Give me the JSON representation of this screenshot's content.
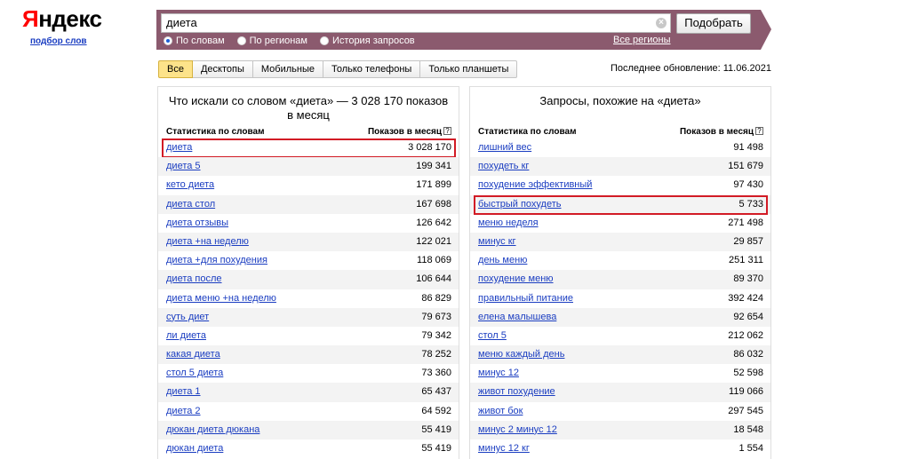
{
  "logo": {
    "text_first": "Я",
    "text_rest": "ндекс",
    "subtitle": "подбор слов"
  },
  "search": {
    "value": "диета",
    "clear_icon": "×",
    "submit_label": "Подобрать",
    "modes": [
      {
        "label": "По словам",
        "selected": true
      },
      {
        "label": "По регионам",
        "selected": false
      },
      {
        "label": "История запросов",
        "selected": false
      }
    ],
    "regions_link": "Все регионы"
  },
  "tabs": [
    {
      "label": "Все",
      "active": true
    },
    {
      "label": "Десктопы",
      "active": false
    },
    {
      "label": "Мобильные",
      "active": false
    },
    {
      "label": "Только телефоны",
      "active": false
    },
    {
      "label": "Только планшеты",
      "active": false
    }
  ],
  "last_update": "Последнее обновление: 11.06.2021",
  "left_panel": {
    "title": "Что искали со словом «диета» — 3 028 170 показов в месяц",
    "col_keyword": "Статистика по словам",
    "col_count": "Показов в месяц",
    "help_icon": "?",
    "rows": [
      {
        "keyword": "диета",
        "count": "3 028 170",
        "highlighted": true
      },
      {
        "keyword": "диета 5",
        "count": "199 341"
      },
      {
        "keyword": "кето диета",
        "count": "171 899"
      },
      {
        "keyword": "диета стол",
        "count": "167 698"
      },
      {
        "keyword": "диета отзывы",
        "count": "126 642"
      },
      {
        "keyword": "диета +на неделю",
        "count": "122 021"
      },
      {
        "keyword": "диета +для похудения",
        "count": "118 069"
      },
      {
        "keyword": "диета после",
        "count": "106 644"
      },
      {
        "keyword": "диета меню +на неделю",
        "count": "86 829"
      },
      {
        "keyword": "суть диет",
        "count": "79 673"
      },
      {
        "keyword": "ли диета",
        "count": "79 342"
      },
      {
        "keyword": "какая диета",
        "count": "78 252"
      },
      {
        "keyword": "стол 5 диета",
        "count": "73 360"
      },
      {
        "keyword": "диета 1",
        "count": "65 437"
      },
      {
        "keyword": "диета 2",
        "count": "64 592"
      },
      {
        "keyword": "дюкан диета дюкана",
        "count": "55 419"
      },
      {
        "keyword": "дюкан диета",
        "count": "55 419"
      }
    ]
  },
  "right_panel": {
    "title": "Запросы, похожие на «диета»",
    "col_keyword": "Статистика по словам",
    "col_count": "Показов в месяц",
    "help_icon": "?",
    "rows": [
      {
        "keyword": "лишний вес",
        "count": "91 498"
      },
      {
        "keyword": "похудеть кг",
        "count": "151 679"
      },
      {
        "keyword": "похудение эффективный",
        "count": "97 430"
      },
      {
        "keyword": "быстрый похудеть",
        "count": "5 733",
        "highlighted": true
      },
      {
        "keyword": "меню неделя",
        "count": "271 498"
      },
      {
        "keyword": "минус кг",
        "count": "29 857"
      },
      {
        "keyword": "день меню",
        "count": "251 311"
      },
      {
        "keyword": "похудение меню",
        "count": "89 370"
      },
      {
        "keyword": "правильный питание",
        "count": "392 424"
      },
      {
        "keyword": "елена малышева",
        "count": "92 654"
      },
      {
        "keyword": "стол 5",
        "count": "212 062"
      },
      {
        "keyword": "меню каждый день",
        "count": "86 032"
      },
      {
        "keyword": "минус 12",
        "count": "52 598"
      },
      {
        "keyword": "живот похудение",
        "count": "119 066"
      },
      {
        "keyword": "живот бок",
        "count": "297 545"
      },
      {
        "keyword": "минус 2 минус 12",
        "count": "18 548"
      },
      {
        "keyword": "минус 12 кг",
        "count": "1 554"
      }
    ]
  }
}
